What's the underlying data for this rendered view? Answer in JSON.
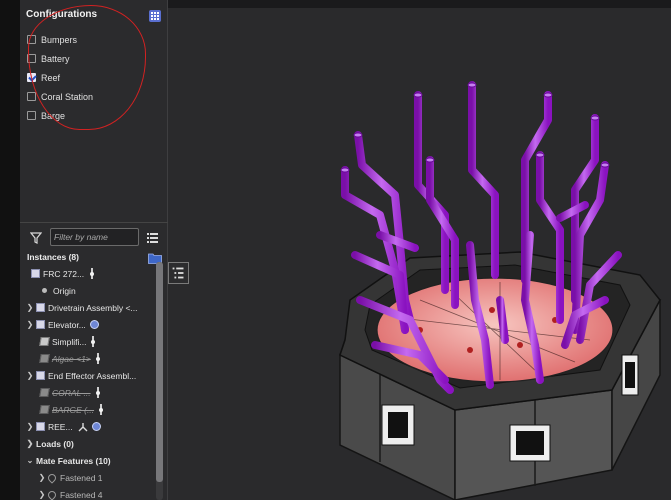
{
  "configurations": {
    "title": "Configurations",
    "options": [
      {
        "label": "Bumpers",
        "checked": false
      },
      {
        "label": "Battery",
        "checked": false
      },
      {
        "label": "Reef",
        "checked": true
      },
      {
        "label": "Coral Station",
        "checked": false
      },
      {
        "label": "Barge",
        "checked": false
      }
    ]
  },
  "filter": {
    "placeholder": "Filter by name"
  },
  "instances": {
    "header": "Instances (8)",
    "root": "FRC 272...",
    "origin": "Origin",
    "items": [
      "Drivetrain Assembly <...",
      "Elevator...",
      "Simplifi...",
      "Algae <1>",
      "End Effector Assembl...",
      "CORAL ...",
      "BARGE (...",
      "REE..."
    ],
    "loads": "Loads (0)",
    "mate_features": "Mate Features (10)",
    "mates": [
      "Fastened 1",
      "Fastened 4"
    ]
  },
  "colors": {
    "accent_purple": "#a020d8",
    "annotation_red": "#d22222",
    "panel_bg": "#2b2b2d"
  },
  "icons": [
    "grid-icon",
    "filter-icon",
    "list-icon",
    "add-folder-icon",
    "tree-toggle-icon"
  ]
}
